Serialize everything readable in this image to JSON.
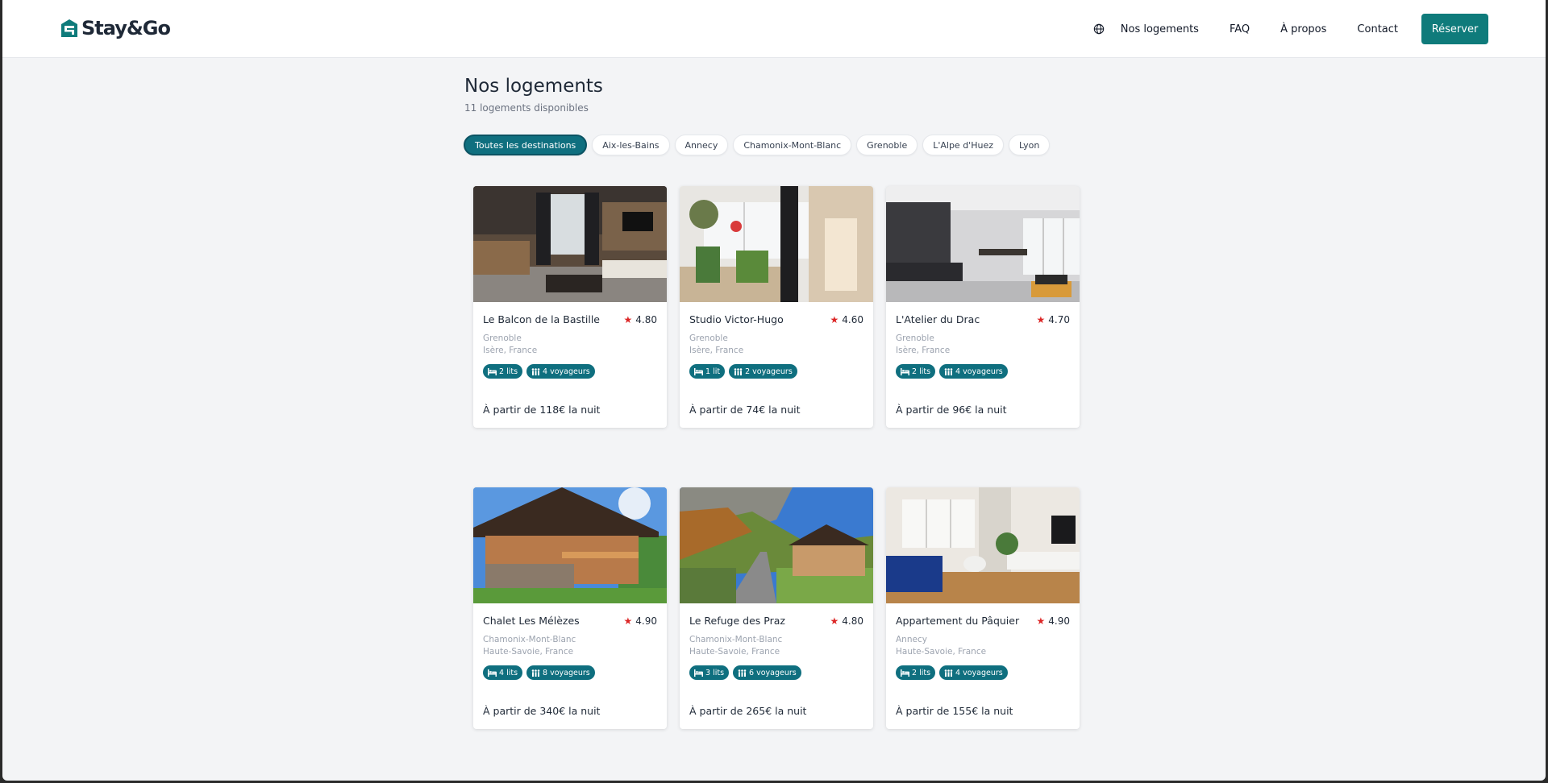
{
  "brand": {
    "name": "Stay&Go",
    "color": "#0f7b7b"
  },
  "nav": {
    "items": [
      "Nos logements",
      "FAQ",
      "À propos",
      "Contact"
    ],
    "cta": "Réserver"
  },
  "page": {
    "title": "Nos logements",
    "subtitle": "11 logements disponibles"
  },
  "filters": [
    "Toutes les destinations",
    "Aix-les-Bains",
    "Annecy",
    "Chamonix-Mont-Blanc",
    "Grenoble",
    "L'Alpe d'Huez",
    "Lyon"
  ],
  "listings": [
    {
      "title": "Le Balcon de la Bastille",
      "rating": "4.80",
      "city": "Grenoble",
      "region": "Isère, France",
      "beds": "2 lits",
      "guests": "4 voyageurs",
      "price": "À partir de 118€ la nuit",
      "image": "living-room-photo"
    },
    {
      "title": "Studio Victor-Hugo",
      "rating": "4.60",
      "city": "Grenoble",
      "region": "Isère, France",
      "beds": "1 lit",
      "guests": "2 voyageurs",
      "price": "À partir de 74€ la nuit",
      "image": "studio-plants-photo"
    },
    {
      "title": "L'Atelier du Drac",
      "rating": "4.70",
      "city": "Grenoble",
      "region": "Isère, France",
      "beds": "2 lits",
      "guests": "4 voyageurs",
      "price": "À partir de 96€ la nuit",
      "image": "kitchen-dining-photo"
    },
    {
      "title": "Chalet Les Mélèzes",
      "rating": "4.90",
      "city": "Chamonix-Mont-Blanc",
      "region": "Haute-Savoie, France",
      "beds": "4 lits",
      "guests": "8 voyageurs",
      "price": "À partir de 340€ la nuit",
      "image": "wooden-chalet-photo"
    },
    {
      "title": "Le Refuge des Praz",
      "rating": "4.80",
      "city": "Chamonix-Mont-Blanc",
      "region": "Haute-Savoie, France",
      "beds": "3 lits",
      "guests": "6 voyageurs",
      "price": "À partir de 265€ la nuit",
      "image": "mountain-chalet-photo"
    },
    {
      "title": "Appartement du Pâquier",
      "rating": "4.90",
      "city": "Annecy",
      "region": "Haute-Savoie, France",
      "beds": "2 lits",
      "guests": "4 voyageurs",
      "price": "À partir de 155€ la nuit",
      "image": "blue-sofa-living-photo"
    }
  ]
}
